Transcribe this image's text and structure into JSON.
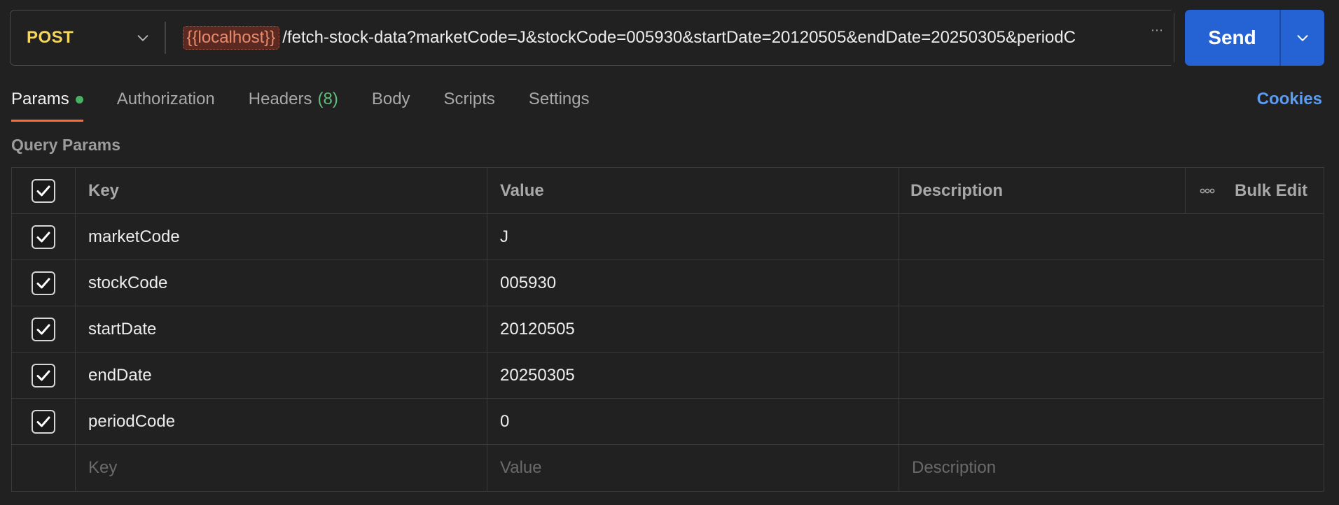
{
  "request": {
    "method": "POST",
    "url_variable": "{{localhost}}",
    "url_path": "/fetch-stock-data?marketCode=J&stockCode=005930&startDate=20120505&endDate=20250305&periodC",
    "overflow_indicator": "⋯",
    "send_label": "Send"
  },
  "tabs": {
    "params": "Params",
    "authorization": "Authorization",
    "headers": "Headers",
    "headers_count": "(8)",
    "body": "Body",
    "scripts": "Scripts",
    "settings": "Settings",
    "active": "params"
  },
  "cookies_label": "Cookies",
  "query_params": {
    "title": "Query Params",
    "columns": {
      "key": "Key",
      "value": "Value",
      "description": "Description",
      "bulk_edit": "Bulk Edit"
    },
    "rows": [
      {
        "key": "marketCode",
        "value": "J",
        "description": "",
        "enabled": true
      },
      {
        "key": "stockCode",
        "value": "005930",
        "description": "",
        "enabled": true
      },
      {
        "key": "startDate",
        "value": "20120505",
        "description": "",
        "enabled": true
      },
      {
        "key": "endDate",
        "value": "20250305",
        "description": "",
        "enabled": true
      },
      {
        "key": "periodCode",
        "value": "0",
        "description": "",
        "enabled": true
      }
    ],
    "new_row_placeholders": {
      "key": "Key",
      "value": "Value",
      "description": "Description"
    }
  },
  "colors": {
    "background": "#212121",
    "method": "#f5d65c",
    "send": "#2563d5",
    "active_tab_underline": "#ff6c37",
    "params_dot": "#49b063",
    "cookies": "#5b9bf0",
    "variable_token": "#e98b6b"
  }
}
